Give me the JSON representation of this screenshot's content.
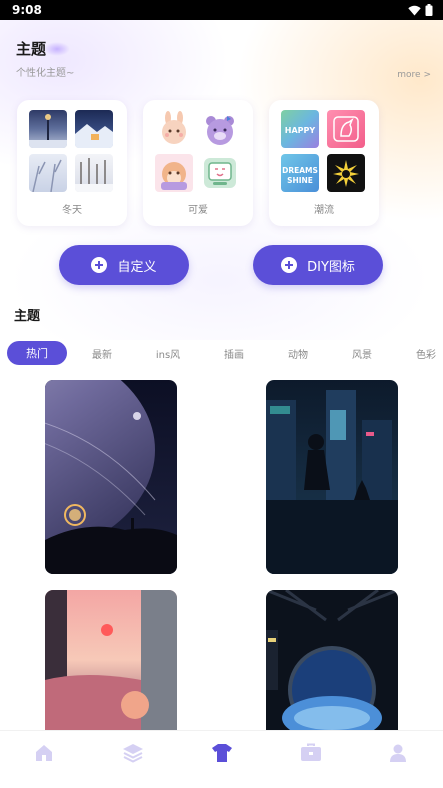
{
  "status_bar": {
    "time": "9:08"
  },
  "header": {
    "title": "主题",
    "subtitle": "个性化主题~",
    "more": "more >"
  },
  "theme_cards": [
    {
      "label": "冬天"
    },
    {
      "label": "可爱"
    },
    {
      "label": "潮流"
    }
  ],
  "trend_thumbs": {
    "happy": "HAPPY",
    "dreams": "DREAMS",
    "shine": "SHINE"
  },
  "actions": {
    "custom": "自定义",
    "diy_icon": "DIY图标"
  },
  "section": {
    "title": "主题"
  },
  "tabs": [
    "热门",
    "最新",
    "ins风",
    "插画",
    "动物",
    "风景",
    "色彩"
  ],
  "active_tab": "热门",
  "colors": {
    "accent": "#5b4fd8",
    "nav_inactive": "#d5d0f3",
    "nav_active": "#5b4fd8"
  },
  "bottom_nav": [
    {
      "icon": "home-icon",
      "active": false
    },
    {
      "icon": "layers-icon",
      "active": false
    },
    {
      "icon": "tshirt-icon",
      "active": true
    },
    {
      "icon": "briefcase-icon",
      "active": false
    },
    {
      "icon": "profile-icon",
      "active": false
    }
  ]
}
